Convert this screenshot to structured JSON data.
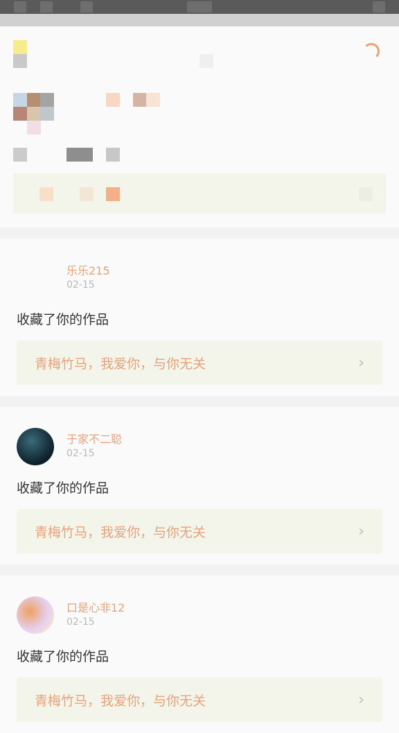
{
  "colors": {
    "accent": "#e6a27a",
    "date_gray": "#b8b8b8",
    "work_box_bg": "#f3f4ea",
    "background": "#f2f2f2",
    "card_bg": "#fafafa"
  },
  "feed": [
    {
      "user": "乐乐215",
      "date": "02-15",
      "action": "收藏了你的作品",
      "work_title": "青梅竹马，我爱你，与你无关"
    },
    {
      "user": "于家不二聪",
      "date": "02-15",
      "action": "收藏了你的作品",
      "work_title": "青梅竹马，我爱你，与你无关"
    },
    {
      "user": "口是心非12",
      "date": "02-15",
      "action": "收藏了你的作品",
      "work_title": "青梅竹马，我爱你，与你无关"
    }
  ],
  "icons": {
    "loading": "loading-spinner-icon",
    "chevron": "chevron-right-icon"
  }
}
